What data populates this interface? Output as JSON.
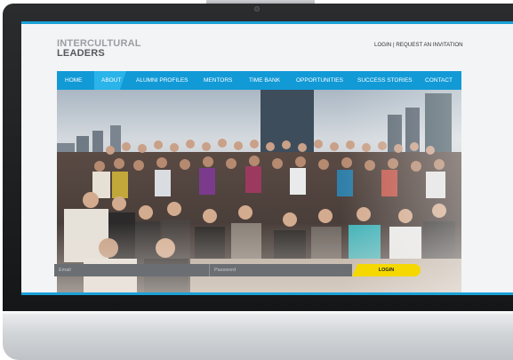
{
  "logo": {
    "line1": "INTERCULTURAL",
    "line2": "LEADERS"
  },
  "top_links": {
    "login": "LOGIN",
    "separator": "|",
    "request": "REQUEST AN INVITATION"
  },
  "nav": {
    "items": [
      {
        "label": "HOME"
      },
      {
        "label": "ABOUT"
      },
      {
        "label": "ALUMNI PROFILES"
      },
      {
        "label": "MENTORS"
      },
      {
        "label": "TIME BANK"
      },
      {
        "label": "OPPORTUNITIES"
      },
      {
        "label": "SUCCESS STORIES"
      },
      {
        "label": "CONTACT"
      }
    ],
    "active_index": 1
  },
  "login_form": {
    "email_placeholder": "Email",
    "password_placeholder": "Password",
    "button_label": "LOGIN"
  },
  "colors": {
    "accent": "#129ad6",
    "active_nav": "#2ab4ea",
    "login_button": "#f5d800",
    "bezel": "#1e1f21"
  }
}
